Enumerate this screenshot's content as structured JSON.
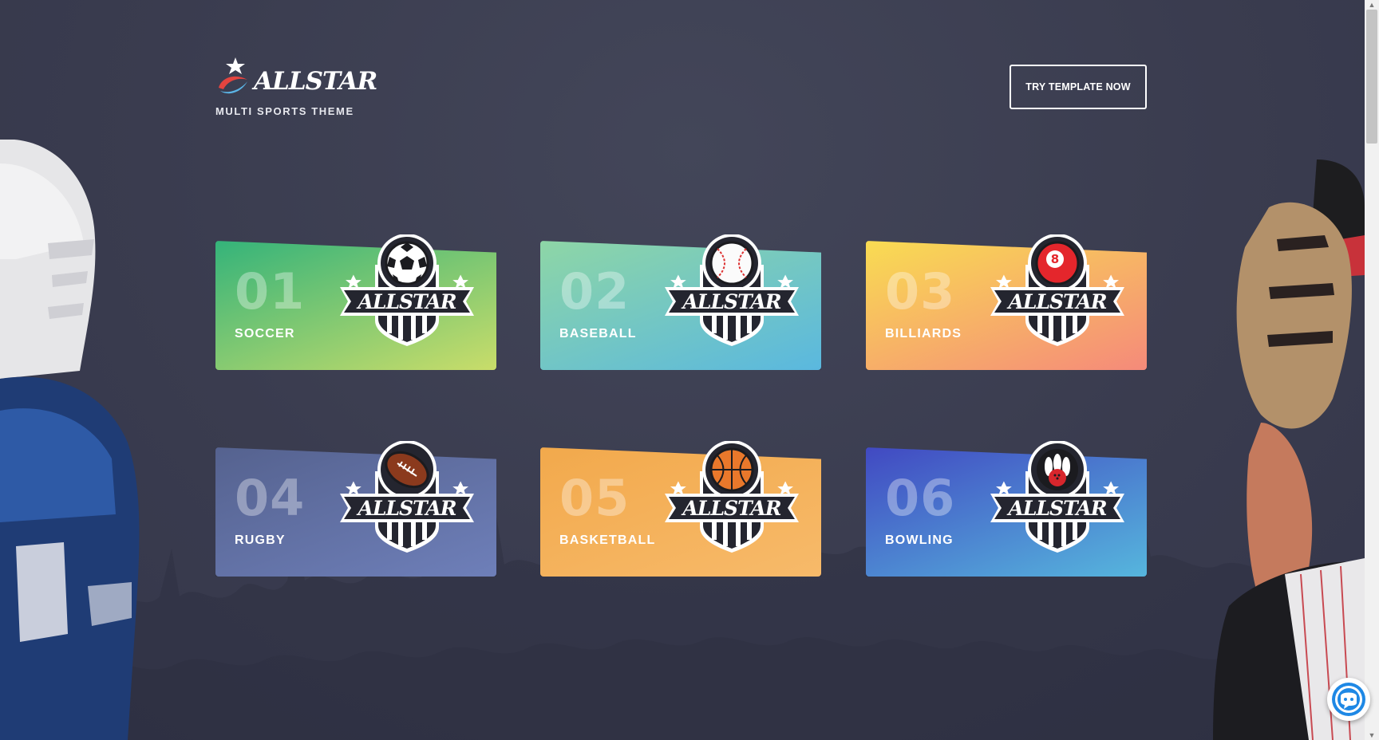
{
  "brand": {
    "name": "ALLSTAR",
    "tagline": "MULTI SPORTS THEME"
  },
  "header": {
    "cta_label": "TRY TEMPLATE NOW"
  },
  "cards": [
    {
      "number": "01",
      "label": "SOCCER",
      "icon": "soccer-ball-icon",
      "gradient": [
        "#34b37a",
        "#c9dd6a"
      ]
    },
    {
      "number": "02",
      "label": "BASEBALL",
      "icon": "baseball-icon",
      "gradient": [
        "#8ed6a6",
        "#5ab8df"
      ]
    },
    {
      "number": "03",
      "label": "BILLIARDS",
      "icon": "billiard-ball-8-icon",
      "gradient": [
        "#f9dc52",
        "#f58a7a"
      ]
    },
    {
      "number": "04",
      "label": "RUGBY",
      "icon": "rugby-ball-icon",
      "gradient": [
        "#55628f",
        "#6e7fb9"
      ]
    },
    {
      "number": "05",
      "label": "BASKETBALL",
      "icon": "basketball-icon",
      "gradient": [
        "#f2a94c",
        "#f7ba6a"
      ]
    },
    {
      "number": "06",
      "label": "BOWLING",
      "icon": "bowling-pins-icon",
      "gradient": [
        "#4149c2",
        "#56b6dd"
      ]
    }
  ],
  "badge_text": "ALLSTAR",
  "colors": {
    "background": "#3b3d51",
    "badge_dark": "#24252f"
  }
}
